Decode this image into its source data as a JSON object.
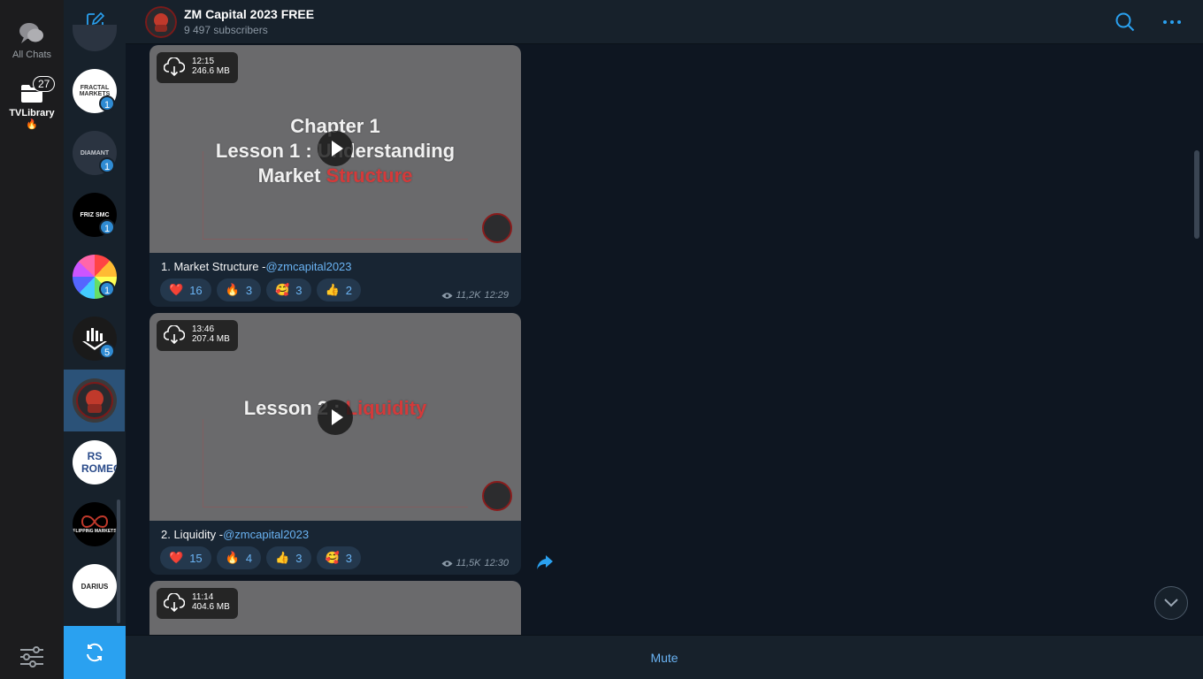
{
  "folders": {
    "all_chats": "All Chats",
    "tvlibrary": "TVLibrary",
    "tvlibrary_emoji": "🔥",
    "tvlibrary_badge": "27"
  },
  "chat_list": {
    "items": [
      {
        "name": "FRACTAL MARKETS",
        "unread": "1",
        "bg": "#ffffff",
        "fg": "#333333"
      },
      {
        "name": "DIAMANT",
        "unread": "1",
        "bg": "#2b3441",
        "fg": "#c8ccd2"
      },
      {
        "name": "FRIZ SMC",
        "unread": "1",
        "bg": "#000000",
        "fg": "#ffffff"
      },
      {
        "name": "",
        "unread": "1",
        "bg": "#ffffff",
        "fg": "#ffffff"
      },
      {
        "name": "",
        "unread": "5",
        "bg": "#1a1a1a",
        "fg": "#ffffff"
      },
      {
        "name": "",
        "unread": "",
        "bg": "#3a3a3c",
        "fg": "#ffffff"
      },
      {
        "name": "RS ROMEO",
        "unread": "",
        "bg": "#ffffff",
        "fg": "#2a4b8a"
      },
      {
        "name": "FLIPPING MARKETS",
        "unread": "",
        "bg": "#000000",
        "fg": "#ffffff"
      },
      {
        "name": "DARIUS",
        "unread": "",
        "bg": "#ffffff",
        "fg": "#222222"
      }
    ]
  },
  "header": {
    "title": "ZM Capital 2023 FREE",
    "subscribers": "9 497 subscribers"
  },
  "messages": [
    {
      "duration": "12:15",
      "size": "246.6 MB",
      "video_line1": "Chapter 1",
      "video_line2_a": "Lesson 1 : U",
      "video_line2_b": "nderstanding",
      "video_line3_a": "Market ",
      "video_line3_b": "Structure",
      "caption_text": "1. Market Structure -",
      "caption_link": "@zmcapital2023",
      "reactions": [
        {
          "emoji": "❤️",
          "count": "16"
        },
        {
          "emoji": "🔥",
          "count": "3"
        },
        {
          "emoji": "🥰",
          "count": "3"
        },
        {
          "emoji": "👍",
          "count": "2"
        }
      ],
      "views": "11,2K",
      "time": "12:29"
    },
    {
      "duration": "13:46",
      "size": "207.4 MB",
      "video_line1_a": "Lesson 2 : ",
      "video_line1_b": "Liquidity",
      "caption_text": "2. Liquidity -",
      "caption_link": "@zmcapital2023",
      "reactions": [
        {
          "emoji": "❤️",
          "count": "15"
        },
        {
          "emoji": "🔥",
          "count": "4"
        },
        {
          "emoji": "👍",
          "count": "3"
        },
        {
          "emoji": "🥰",
          "count": "3"
        }
      ],
      "views": "11,5K",
      "time": "12:30"
    },
    {
      "duration": "11:14",
      "size": "404.6 MB"
    }
  ],
  "footer": {
    "mute_label": "Mute"
  },
  "colors": {
    "accent": "#2aa1f0",
    "link": "#6ab3f3",
    "selected": "#2b5278"
  }
}
